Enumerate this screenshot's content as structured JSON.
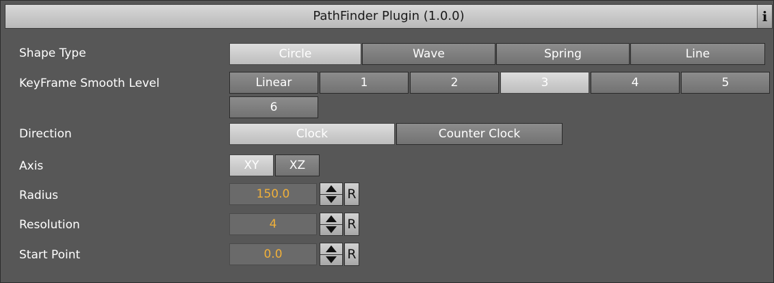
{
  "title": "PathFinder Plugin (1.0.0)",
  "info_label": "i",
  "shape_type": {
    "label": "Shape Type",
    "options": [
      "Circle",
      "Wave",
      "Spring",
      "Line"
    ],
    "selected": "Circle"
  },
  "smooth": {
    "label": "KeyFrame Smooth Level",
    "options": [
      "Linear",
      "1",
      "2",
      "3",
      "4",
      "5",
      "6"
    ],
    "selected": "3"
  },
  "direction": {
    "label": "Direction",
    "options": [
      "Clock",
      "Counter Clock"
    ],
    "selected": "Clock"
  },
  "axis": {
    "label": "Axis",
    "options": [
      "XY",
      "XZ"
    ],
    "selected": "XY"
  },
  "radius": {
    "label": "Radius",
    "value": "150.0",
    "reset": "R"
  },
  "resolution": {
    "label": "Resolution",
    "value": "4",
    "reset": "R"
  },
  "start_point": {
    "label": "Start Point",
    "value": "0.0",
    "reset": "R"
  },
  "colors": {
    "value_text": "#f0b03a",
    "panel_bg": "#575757",
    "selected_button": "#cdcdcd"
  }
}
